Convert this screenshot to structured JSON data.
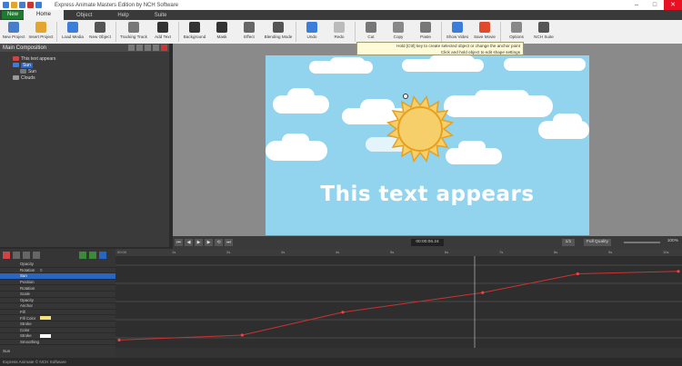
{
  "window": {
    "title": "Express Animate Masters Edition by NCH Software",
    "controls": {
      "minimize": "–",
      "maximize": "□",
      "close": "✕"
    }
  },
  "menu": {
    "new_label": "New",
    "items": [
      "Home",
      "Object",
      "Help",
      "Suite"
    ]
  },
  "ribbon": [
    {
      "label": "New Project",
      "color": "#4a7dc9"
    },
    {
      "label": "Insert Project",
      "color": "#e2a530"
    },
    {
      "label": "Load Media",
      "color": "#3b7dd8"
    },
    {
      "label": "New Object",
      "color": "#555555"
    },
    {
      "label": "Tracking Track",
      "color": "#777777"
    },
    {
      "label": "Add Text",
      "color": "#333333"
    },
    {
      "label": "Background",
      "color": "#333333"
    },
    {
      "label": "Mask",
      "color": "#333333"
    },
    {
      "label": "Effect",
      "color": "#666666"
    },
    {
      "label": "Blending Mode",
      "color": "#555555"
    },
    {
      "label": "Undo",
      "color": "#3b7dd8"
    },
    {
      "label": "Redo",
      "color": "#bbbbbb"
    },
    {
      "label": "Cut",
      "color": "#777777"
    },
    {
      "label": "Copy",
      "color": "#888888"
    },
    {
      "label": "Paste",
      "color": "#777777"
    },
    {
      "label": "Show Video",
      "color": "#3b7dd8"
    },
    {
      "label": "Save Movie",
      "color": "#e04a2b"
    },
    {
      "label": "Options",
      "color": "#888888"
    },
    {
      "label": "NCH Suite",
      "color": "#555555"
    }
  ],
  "tooltip": {
    "line1": "Hold [Ctrl] key to create selected object or change the anchor point",
    "line2": "Click and hold object to edit shape settings"
  },
  "left_panel": {
    "title": "Main Composition",
    "tree": [
      {
        "label": "This text appears",
        "indent": 1,
        "color": "#c44",
        "selected": false
      },
      {
        "label": "Sun",
        "indent": 1,
        "color": "#3b7dd8",
        "selected": true
      },
      {
        "label": "Sun",
        "indent": 2,
        "color": "#777",
        "selected": false
      },
      {
        "label": "Clouds",
        "indent": 1,
        "color": "#999",
        "selected": false
      }
    ]
  },
  "canvas": {
    "text": "This text appears",
    "sky_color": "#92d4ee",
    "sun_color": "#f6cf6a",
    "sun_rim": "#e6a020"
  },
  "playback": {
    "timecode": "00:00:06.24",
    "zoom": "1/1",
    "quality": "Full Quality",
    "percent": "100%"
  },
  "timeline": {
    "properties": [
      {
        "name": "Opacity",
        "value": "",
        "selected": false
      },
      {
        "name": "Rotation",
        "value": "0",
        "selected": false
      },
      {
        "name": "Sun",
        "value": "",
        "selected": true
      },
      {
        "name": "Position",
        "value": "",
        "selected": false
      },
      {
        "name": "Rotation",
        "value": "",
        "selected": false
      },
      {
        "name": "Scale",
        "value": "",
        "selected": false
      },
      {
        "name": "Opacity",
        "value": "",
        "selected": false
      },
      {
        "name": "Anchor",
        "value": "",
        "selected": false
      },
      {
        "name": "Fill",
        "value": "",
        "selected": false
      },
      {
        "name": "Fill Color",
        "value": "",
        "selected": false,
        "swatch": "#f6e27a"
      },
      {
        "name": "Stroke",
        "value": "",
        "selected": false
      },
      {
        "name": "Color",
        "value": "",
        "selected": false
      },
      {
        "name": "Stroke",
        "value": "",
        "selected": false,
        "swatch": "#ffffff"
      },
      {
        "name": "Smoothing",
        "value": "",
        "selected": false
      }
    ],
    "graph_points": [
      {
        "t": 0.0,
        "v": 0.04
      },
      {
        "t": 0.22,
        "v": 0.1
      },
      {
        "t": 0.4,
        "v": 0.38
      },
      {
        "t": 0.65,
        "v": 0.62
      },
      {
        "t": 0.82,
        "v": 0.85
      },
      {
        "t": 1.0,
        "v": 0.88
      }
    ],
    "ruler_labels": [
      "00:00",
      "1s",
      "2s",
      "3s",
      "4s",
      "5s",
      "6s",
      "7s",
      "8s",
      "9s",
      "10s"
    ],
    "footer_label": "Sun"
  },
  "status": "Express Animate © NCH Software"
}
